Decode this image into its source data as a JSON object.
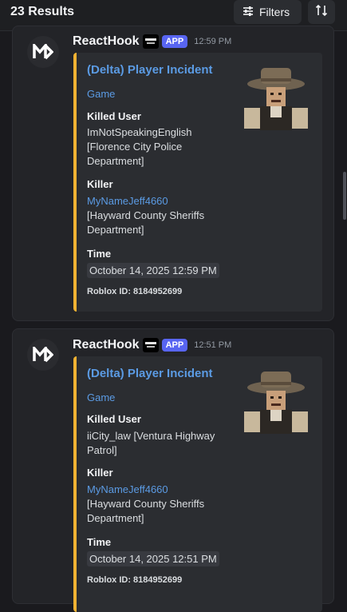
{
  "header": {
    "results_label": "23 Results",
    "filters_label": "Filters",
    "filters_icon": "sliders-icon",
    "sort_icon": "sort-arrows-icon"
  },
  "results": [
    {
      "author": "ReactHook",
      "badge": "APP",
      "timestamp": "12:59 PM",
      "embed": {
        "title": "(Delta) Player Incident",
        "link": "Game",
        "killed_user_label": "Killed User",
        "killed_user_value": "ImNotSpeakingEnglish [Florence City Police Department]",
        "killer_label": "Killer",
        "killer_name": "MyNameJeff4660",
        "killer_team": "[Hayward County Sheriffs Department]",
        "time_label": "Time",
        "time_value": "October 14, 2025 12:59 PM",
        "footer": "Roblox ID: 8184952699",
        "accent_color": "#f0b232"
      }
    },
    {
      "author": "ReactHook",
      "badge": "APP",
      "timestamp": "12:51 PM",
      "embed": {
        "title": "(Delta) Player Incident",
        "link": "Game",
        "killed_user_label": "Killed User",
        "killed_user_value": "iiCity_law [Ventura Highway Patrol]",
        "killer_label": "Killer",
        "killer_name": "MyNameJeff4660",
        "killer_team": "[Hayward County Sheriffs Department]",
        "time_label": "Time",
        "time_value": "October 14, 2025 12:51 PM",
        "footer": "Roblox ID: 8184952699",
        "accent_color": "#f0b232"
      }
    }
  ],
  "colors": {
    "background": "#1a1a1e",
    "link_blue": "#5b9be4",
    "app_badge": "#5865f2"
  }
}
